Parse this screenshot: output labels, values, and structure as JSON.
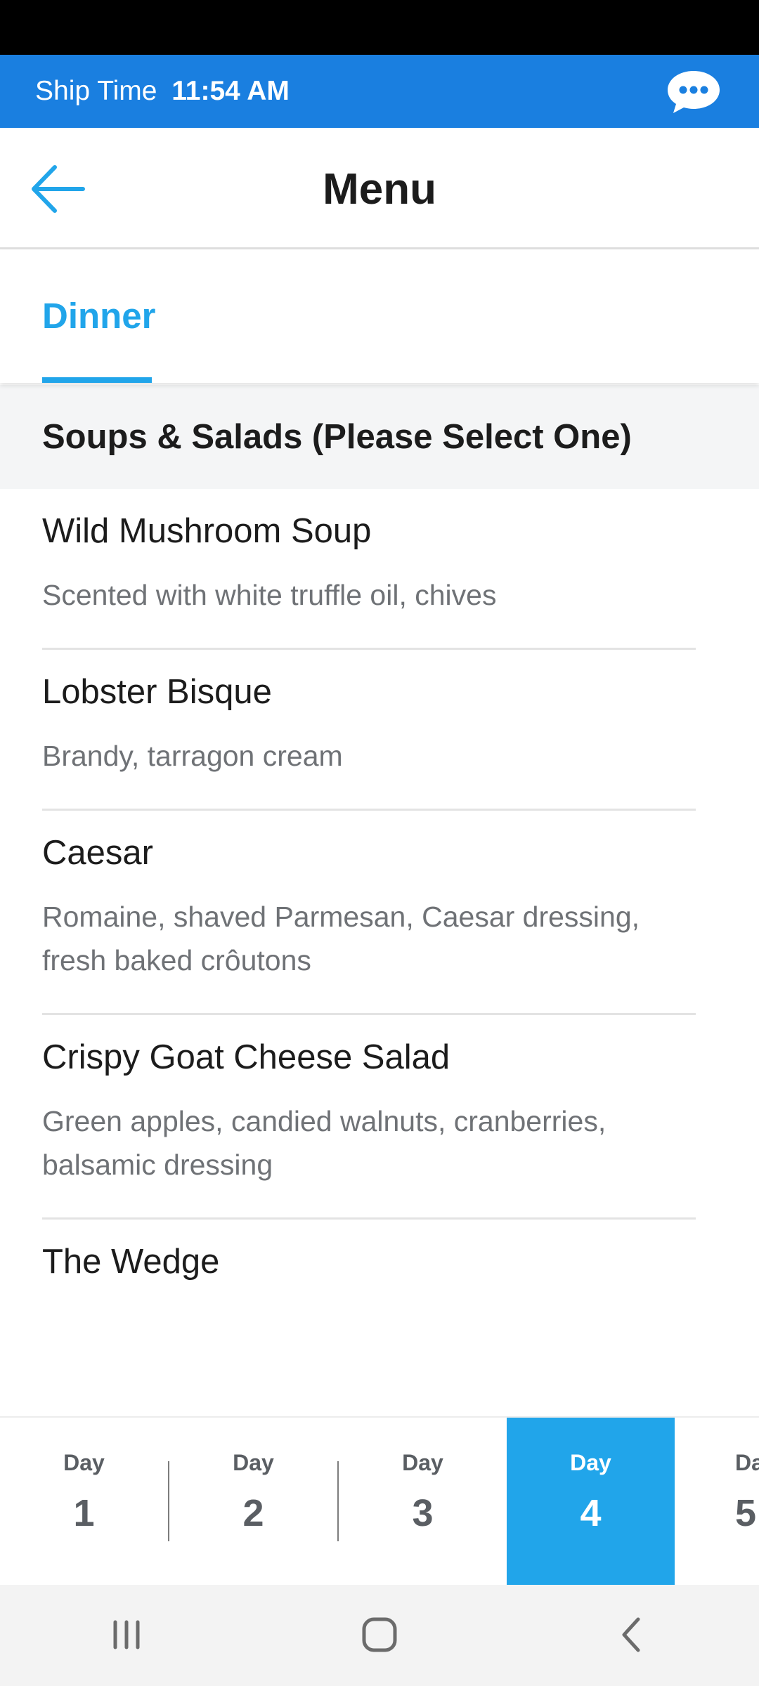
{
  "ship_bar": {
    "label": "Ship Time",
    "time": "11:54 AM",
    "chat_icon": "chat-bubble-icon"
  },
  "header": {
    "title": "Menu",
    "back_icon": "arrow-left-icon"
  },
  "tabs": [
    {
      "label": "Dinner",
      "selected": true
    }
  ],
  "section": {
    "title": "Soups & Salads (Please Select One)"
  },
  "menu_items": [
    {
      "name": "Wild Mushroom Soup",
      "desc": "Scented with white truffle oil, chives"
    },
    {
      "name": "Lobster Bisque",
      "desc": "Brandy, tarragon cream"
    },
    {
      "name": "Caesar",
      "desc": "Romaine, shaved Parmesan, Caesar dressing, fresh baked crôutons"
    },
    {
      "name": "Crispy Goat Cheese Salad",
      "desc": "Green apples, candied walnuts, cranberries, balsamic dressing"
    },
    {
      "name": "The Wedge",
      "desc": ""
    }
  ],
  "days": [
    {
      "label": "Day",
      "number": "1",
      "active": false
    },
    {
      "label": "Day",
      "number": "2",
      "active": false
    },
    {
      "label": "Day",
      "number": "3",
      "active": false
    },
    {
      "label": "Day",
      "number": "4",
      "active": true
    },
    {
      "label": "Da",
      "number": "5",
      "active": false
    }
  ],
  "colors": {
    "ship_bar": "#1a7fe0",
    "accent": "#21a5ea",
    "section_bg": "#f4f5f6",
    "text_dark": "#1c1c1c",
    "text_muted": "#6f7276"
  },
  "system_nav": {
    "recents_icon": "recents-icon",
    "home_icon": "home-icon",
    "back_icon": "back-chevron-icon"
  }
}
